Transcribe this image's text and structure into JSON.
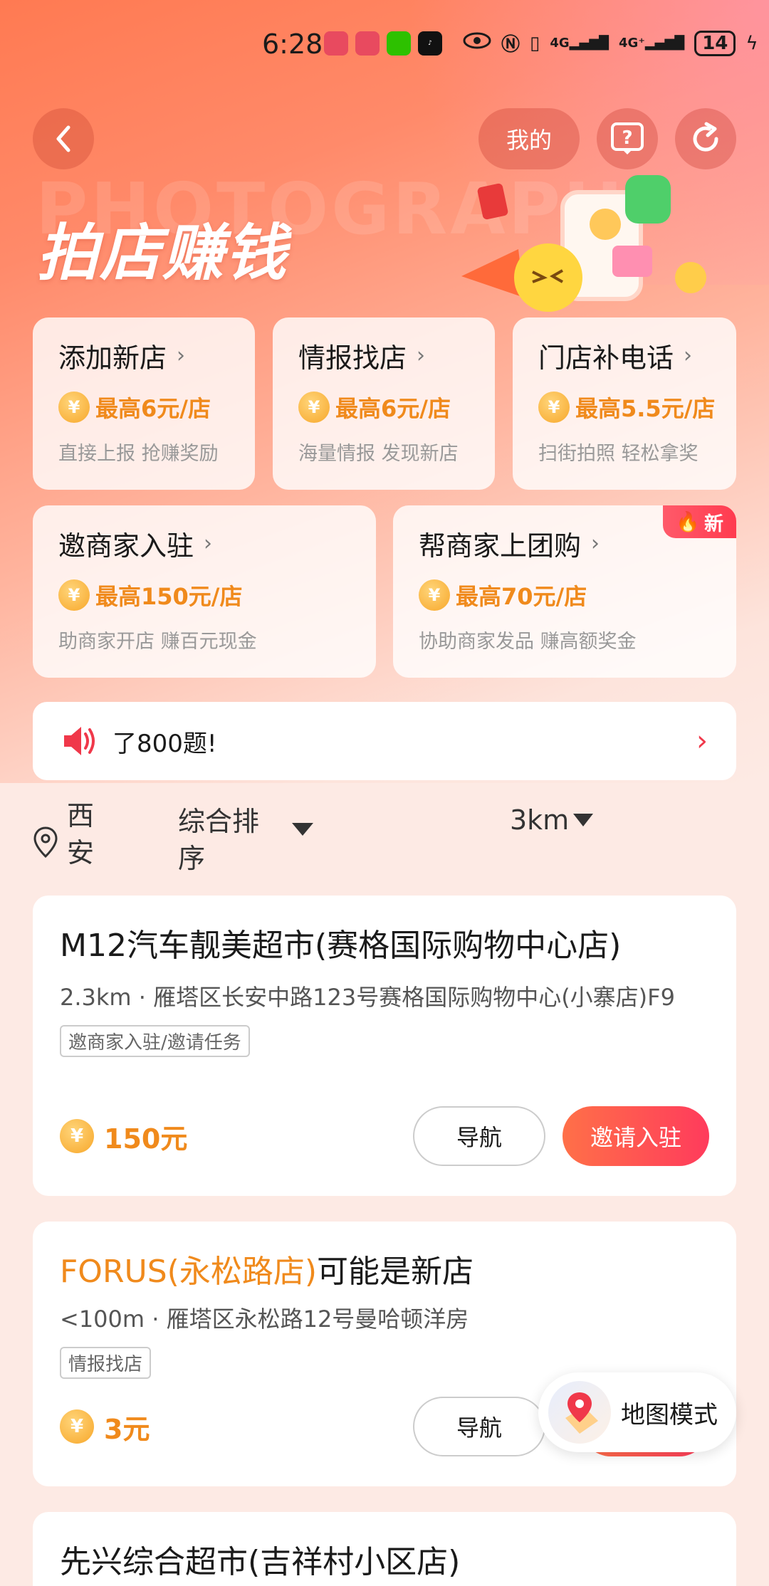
{
  "status_bar": {
    "time": "6:28",
    "network_1": "4G",
    "network_2": "4G⁺",
    "battery": "14"
  },
  "header": {
    "mine_label": "我的",
    "hero_title": "拍店赚钱",
    "watermark": "PHOTOGRAPH"
  },
  "tasks": [
    {
      "title": "添加新店",
      "reward": "最高6元/店",
      "desc": "直接上报 抢赚奖励"
    },
    {
      "title": "情报找店",
      "reward": "最高6元/店",
      "desc": "海量情报 发现新店"
    },
    {
      "title": "门店补电话",
      "reward": "最高5.5元/店",
      "desc": "扫街拍照 轻松拿奖"
    },
    {
      "title": "邀商家入驻",
      "reward": "最高150元/店",
      "desc": "助商家开店 赚百元现金"
    },
    {
      "title": "帮商家上团购",
      "reward": "最高70元/店",
      "desc": "协助商家发品 赚高额奖金",
      "badge": "新"
    }
  ],
  "coin_symbol": "¥",
  "notice": {
    "text": "了800题!"
  },
  "filters": {
    "location": "西安",
    "sort": "综合排序",
    "distance": "3km"
  },
  "stores": [
    {
      "name": "M12汽车靓美超市(赛格国际购物中心店)",
      "distance": "2.3km",
      "address": "雁塔区长安中路123号赛格国际购物中心(小寨店)F9",
      "tag": "邀商家入驻/邀请任务",
      "reward": "150元",
      "nav_label": "导航",
      "action_label": "邀请入驻"
    },
    {
      "name_highlight": "FORUS(永松路店)",
      "name_suffix": "可能是新店",
      "distance": "<100m",
      "address": "雁塔区永松路12号曼哈顿洋房",
      "tag": "情报找店",
      "reward": "3元",
      "nav_label": "导航"
    },
    {
      "name": "先兴综合超市(吉祥村小区店)"
    }
  ],
  "map_mode": {
    "label": "地图模式"
  },
  "colors": {
    "accent_orange": "#f08a1c",
    "accent_red": "#ff3b5c",
    "hero_start": "#ff7a52"
  }
}
